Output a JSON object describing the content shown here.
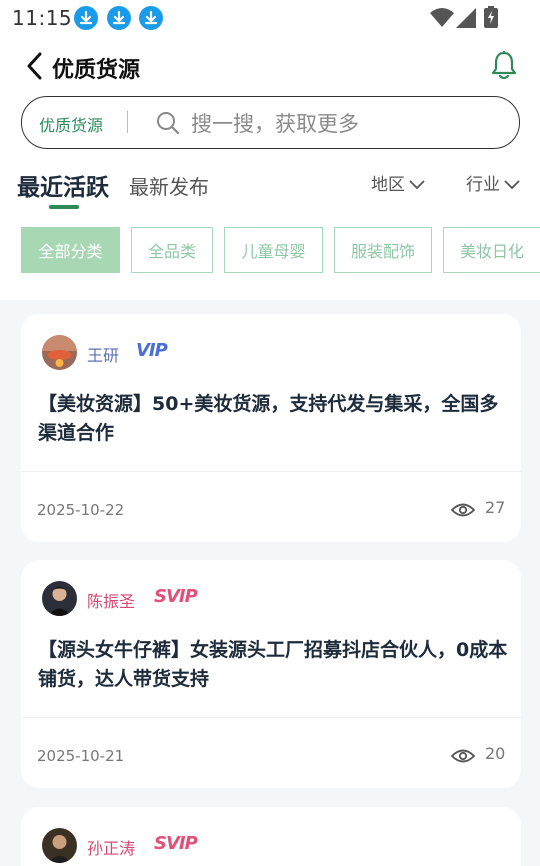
{
  "status_bar": {
    "time": "11:15",
    "icons": [
      "download-icon",
      "download-icon",
      "download-icon",
      "wifi-icon",
      "signal-icon",
      "battery-icon"
    ]
  },
  "header": {
    "title": "优质货源",
    "back_icon": "back-arrow-icon",
    "bell_icon": "bell-icon"
  },
  "search": {
    "scope": "优质货源",
    "placeholder": "搜一搜，获取更多"
  },
  "tabs": [
    {
      "label": "最近活跃",
      "active": true
    },
    {
      "label": "最新发布",
      "active": false
    }
  ],
  "filters": [
    {
      "label": "地区"
    },
    {
      "label": "行业"
    }
  ],
  "categories": [
    {
      "label": "全部分类",
      "active": true
    },
    {
      "label": "全品类",
      "active": false
    },
    {
      "label": "儿童母婴",
      "active": false
    },
    {
      "label": "服装配饰",
      "active": false
    },
    {
      "label": "美妆日化",
      "active": false
    }
  ],
  "posts": [
    {
      "author": "王研",
      "badge": "VIP",
      "title": "【美妆资源】50+美妆货源，支持代发与集采，全国多渠道合作",
      "date": "2025-10-22",
      "views": "27"
    },
    {
      "author": "陈振圣",
      "badge": "SVIP",
      "title": "【源头女牛仔裤】女装源头工厂招募抖店合伙人，0成本铺货，达人带货支持",
      "date": "2025-10-21",
      "views": "20"
    },
    {
      "author": "孙正涛",
      "badge": "SVIP",
      "title": "",
      "date": "",
      "views": ""
    }
  ],
  "colors": {
    "accent": "#2e8b57",
    "chip_active_bg": "#a7d8b3",
    "vip": "#4a6fd6",
    "svip": "#e0527a",
    "author_vip": "#5b6fb5",
    "author_svip": "#d44a73"
  }
}
